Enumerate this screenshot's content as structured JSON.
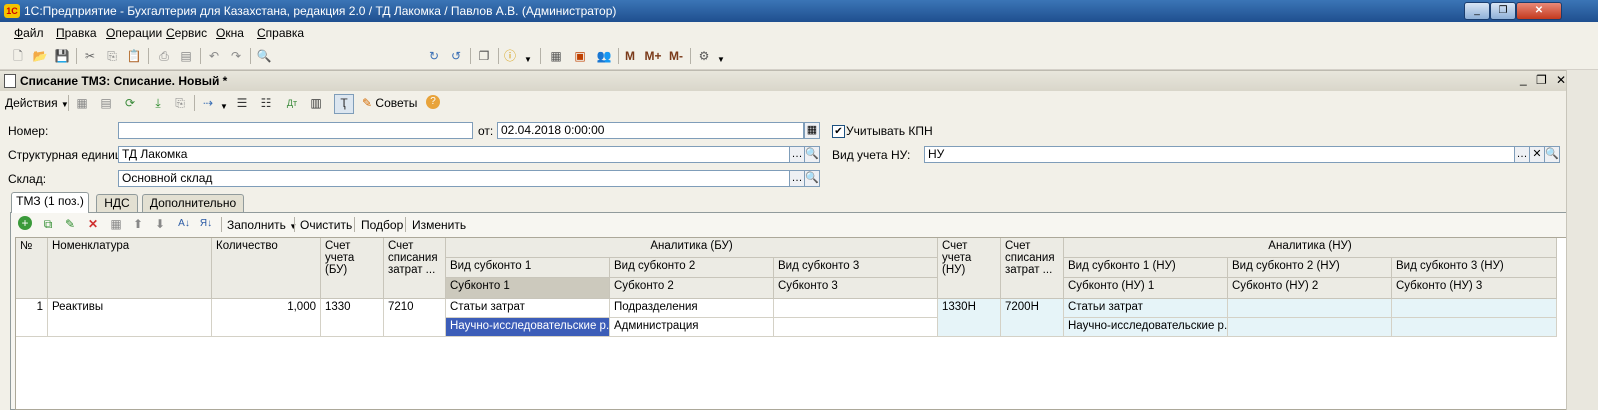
{
  "window": {
    "title": "1С:Предприятие - Бухгалтерия для Казахстана, редакция 2.0 / ТД Лакомка / Павлов А.В. (Администратор)"
  },
  "menu": {
    "items": [
      "Файл",
      "Правка",
      "Операции",
      "Сервис",
      "Окна",
      "Справка"
    ]
  },
  "toolbar": {
    "m": "M",
    "mplus": "M+",
    "mminus": "M-",
    "search_value": ""
  },
  "document": {
    "title": "Списание ТМЗ: Списание. Новый *"
  },
  "doc_toolbar": {
    "actions_label": "Действия",
    "tips_label": "Советы"
  },
  "form": {
    "number_label": "Номер:",
    "number_value": "",
    "date_label": "от:",
    "date_value": "02.04.2018  0:00:00",
    "kpn_label": "Учитывать КПН",
    "kpn_checked": true,
    "unit_label": "Структурная единица:",
    "unit_value": "ТД Лакомка",
    "nu_label": "Вид учета НУ:",
    "nu_value": "НУ",
    "warehouse_label": "Склад:",
    "warehouse_value": "Основной склад"
  },
  "tabs": [
    {
      "label": "ТМЗ (1 поз.)",
      "active": true
    },
    {
      "label": "НДС",
      "active": false
    },
    {
      "label": "Дополнительно",
      "active": false
    }
  ],
  "table_toolbar": {
    "fill_label": "Заполнить",
    "clear_label": "Очистить",
    "pick_label": "Подбор",
    "change_label": "Изменить"
  },
  "table": {
    "headers": {
      "num": "№",
      "nomenclature": "Номенклатура",
      "quantity": "Количество",
      "account_bu": "Счет учета (БУ)",
      "writeoff_bu": "Счет списания затрат ...",
      "analytics_bu": "Аналитика (БУ)",
      "subkonto_kind_1": "Вид субконто 1",
      "subkonto_kind_2": "Вид субконто 2",
      "subkonto_kind_3": "Вид субконто 3",
      "subkonto_1": "Субконто 1",
      "subkonto_2": "Субконто 2",
      "subkonto_3": "Субконто 3",
      "account_nu": "Счет учета (НУ)",
      "writeoff_nu": "Счет списания затрат ...",
      "analytics_nu": "Аналитика (НУ)",
      "subkonto_kind_nu_1": "Вид субконто 1 (НУ)",
      "subkonto_kind_nu_2": "Вид субконто 2 (НУ)",
      "subkonto_kind_nu_3": "Вид субконто 3 (НУ)",
      "subkonto_nu_1": "Субконто (НУ) 1",
      "subkonto_nu_2": "Субконто (НУ) 2",
      "subkonto_nu_3": "Субконто (НУ) 3"
    },
    "rows": [
      {
        "num": "1",
        "nomenclature": "Реактивы",
        "quantity": "1,000",
        "account_bu": "1330",
        "writeoff_bu": "7210",
        "kind1": "Статьи затрат",
        "kind2": "Подразделения",
        "kind3": "",
        "sub1": "Научно-исследовательские р...",
        "sub2": "Администрация",
        "sub3": "",
        "account_nu": "1330Н",
        "writeoff_nu": "7200Н",
        "kind_nu1": "Статьи затрат",
        "kind_nu2": "",
        "kind_nu3": "",
        "sub_nu1": "Научно-исследовательские р...",
        "sub_nu2": "",
        "sub_nu3": ""
      }
    ]
  }
}
